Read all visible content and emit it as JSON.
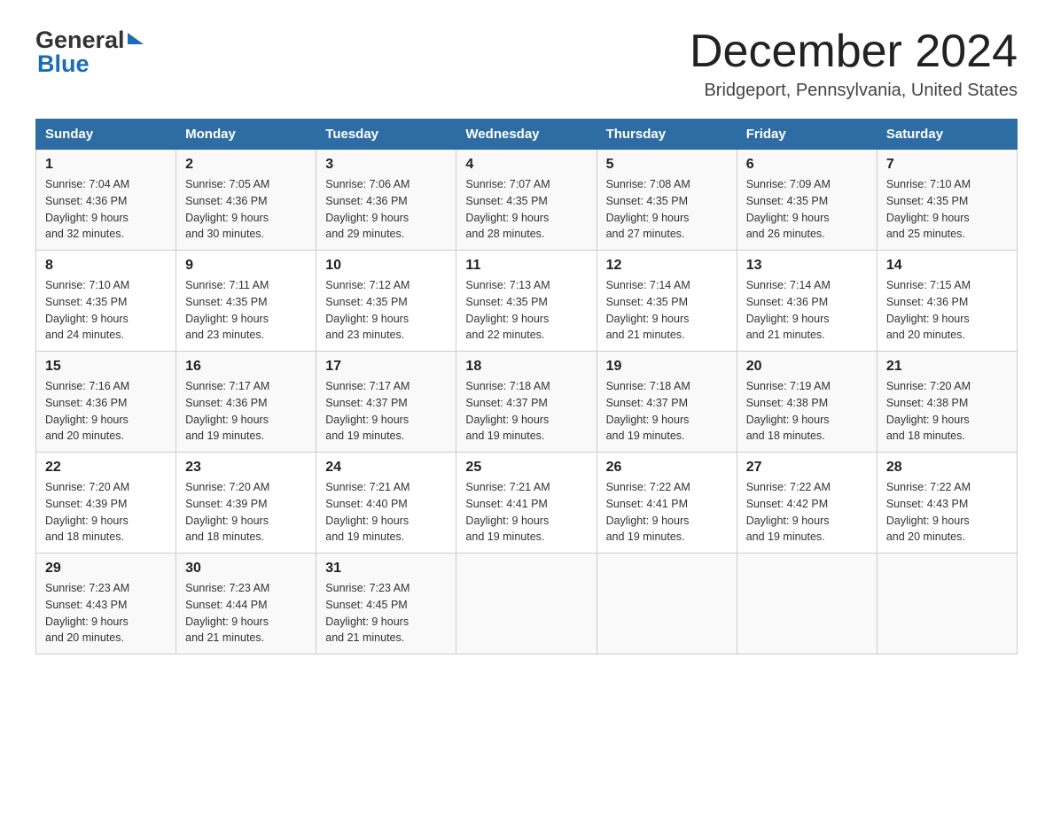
{
  "header": {
    "logo_general": "General",
    "logo_blue": "Blue",
    "month_title": "December 2024",
    "location": "Bridgeport, Pennsylvania, United States"
  },
  "days_of_week": [
    "Sunday",
    "Monday",
    "Tuesday",
    "Wednesday",
    "Thursday",
    "Friday",
    "Saturday"
  ],
  "weeks": [
    [
      {
        "day": "1",
        "sunrise": "7:04 AM",
        "sunset": "4:36 PM",
        "daylight": "9 hours and 32 minutes."
      },
      {
        "day": "2",
        "sunrise": "7:05 AM",
        "sunset": "4:36 PM",
        "daylight": "9 hours and 30 minutes."
      },
      {
        "day": "3",
        "sunrise": "7:06 AM",
        "sunset": "4:36 PM",
        "daylight": "9 hours and 29 minutes."
      },
      {
        "day": "4",
        "sunrise": "7:07 AM",
        "sunset": "4:35 PM",
        "daylight": "9 hours and 28 minutes."
      },
      {
        "day": "5",
        "sunrise": "7:08 AM",
        "sunset": "4:35 PM",
        "daylight": "9 hours and 27 minutes."
      },
      {
        "day": "6",
        "sunrise": "7:09 AM",
        "sunset": "4:35 PM",
        "daylight": "9 hours and 26 minutes."
      },
      {
        "day": "7",
        "sunrise": "7:10 AM",
        "sunset": "4:35 PM",
        "daylight": "9 hours and 25 minutes."
      }
    ],
    [
      {
        "day": "8",
        "sunrise": "7:10 AM",
        "sunset": "4:35 PM",
        "daylight": "9 hours and 24 minutes."
      },
      {
        "day": "9",
        "sunrise": "7:11 AM",
        "sunset": "4:35 PM",
        "daylight": "9 hours and 23 minutes."
      },
      {
        "day": "10",
        "sunrise": "7:12 AM",
        "sunset": "4:35 PM",
        "daylight": "9 hours and 23 minutes."
      },
      {
        "day": "11",
        "sunrise": "7:13 AM",
        "sunset": "4:35 PM",
        "daylight": "9 hours and 22 minutes."
      },
      {
        "day": "12",
        "sunrise": "7:14 AM",
        "sunset": "4:35 PM",
        "daylight": "9 hours and 21 minutes."
      },
      {
        "day": "13",
        "sunrise": "7:14 AM",
        "sunset": "4:36 PM",
        "daylight": "9 hours and 21 minutes."
      },
      {
        "day": "14",
        "sunrise": "7:15 AM",
        "sunset": "4:36 PM",
        "daylight": "9 hours and 20 minutes."
      }
    ],
    [
      {
        "day": "15",
        "sunrise": "7:16 AM",
        "sunset": "4:36 PM",
        "daylight": "9 hours and 20 minutes."
      },
      {
        "day": "16",
        "sunrise": "7:17 AM",
        "sunset": "4:36 PM",
        "daylight": "9 hours and 19 minutes."
      },
      {
        "day": "17",
        "sunrise": "7:17 AM",
        "sunset": "4:37 PM",
        "daylight": "9 hours and 19 minutes."
      },
      {
        "day": "18",
        "sunrise": "7:18 AM",
        "sunset": "4:37 PM",
        "daylight": "9 hours and 19 minutes."
      },
      {
        "day": "19",
        "sunrise": "7:18 AM",
        "sunset": "4:37 PM",
        "daylight": "9 hours and 19 minutes."
      },
      {
        "day": "20",
        "sunrise": "7:19 AM",
        "sunset": "4:38 PM",
        "daylight": "9 hours and 18 minutes."
      },
      {
        "day": "21",
        "sunrise": "7:20 AM",
        "sunset": "4:38 PM",
        "daylight": "9 hours and 18 minutes."
      }
    ],
    [
      {
        "day": "22",
        "sunrise": "7:20 AM",
        "sunset": "4:39 PM",
        "daylight": "9 hours and 18 minutes."
      },
      {
        "day": "23",
        "sunrise": "7:20 AM",
        "sunset": "4:39 PM",
        "daylight": "9 hours and 18 minutes."
      },
      {
        "day": "24",
        "sunrise": "7:21 AM",
        "sunset": "4:40 PM",
        "daylight": "9 hours and 19 minutes."
      },
      {
        "day": "25",
        "sunrise": "7:21 AM",
        "sunset": "4:41 PM",
        "daylight": "9 hours and 19 minutes."
      },
      {
        "day": "26",
        "sunrise": "7:22 AM",
        "sunset": "4:41 PM",
        "daylight": "9 hours and 19 minutes."
      },
      {
        "day": "27",
        "sunrise": "7:22 AM",
        "sunset": "4:42 PM",
        "daylight": "9 hours and 19 minutes."
      },
      {
        "day": "28",
        "sunrise": "7:22 AM",
        "sunset": "4:43 PM",
        "daylight": "9 hours and 20 minutes."
      }
    ],
    [
      {
        "day": "29",
        "sunrise": "7:23 AM",
        "sunset": "4:43 PM",
        "daylight": "9 hours and 20 minutes."
      },
      {
        "day": "30",
        "sunrise": "7:23 AM",
        "sunset": "4:44 PM",
        "daylight": "9 hours and 21 minutes."
      },
      {
        "day": "31",
        "sunrise": "7:23 AM",
        "sunset": "4:45 PM",
        "daylight": "9 hours and 21 minutes."
      },
      null,
      null,
      null,
      null
    ]
  ],
  "labels": {
    "sunrise": "Sunrise:",
    "sunset": "Sunset:",
    "daylight": "Daylight:"
  }
}
